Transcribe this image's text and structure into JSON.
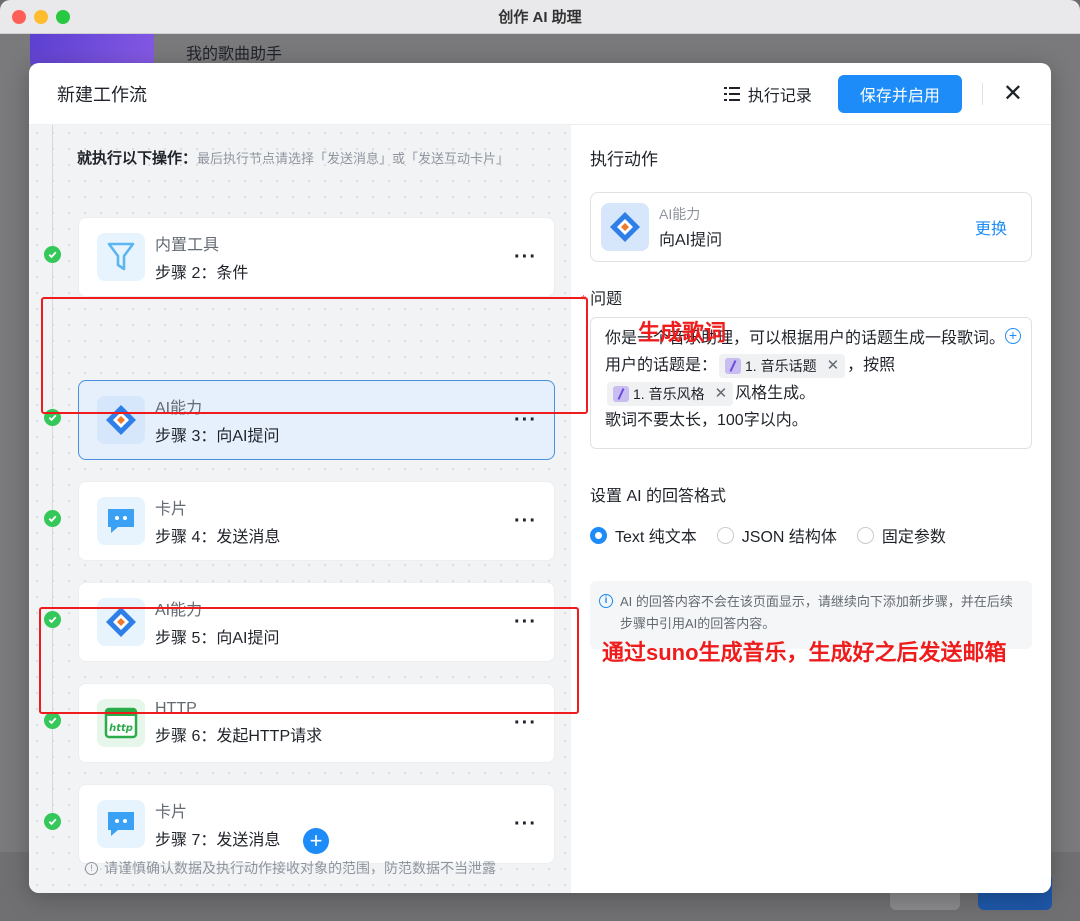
{
  "window": {
    "title": "创作 AI 助理"
  },
  "background": {
    "assistant_name": "我的歌曲助手"
  },
  "modal": {
    "title": "新建工作流",
    "history_label": "执行记录",
    "save_label": "保存并启用",
    "close_label": "✕"
  },
  "left": {
    "heading": "就执行以下操作：",
    "hint": "最后执行节点请选择「发送消息」或「发送互动卡片」",
    "steps": [
      {
        "category": "内置工具",
        "name": "步骤 2：条件",
        "icon": "filter-icon",
        "more": "···"
      },
      {
        "category": "AI能力",
        "name": "步骤 3：向AI提问",
        "icon": "ai-diamond-icon",
        "more": "···"
      },
      {
        "category": "卡片",
        "name": "步骤 4：发送消息",
        "icon": "chat-bubble-icon",
        "more": "···"
      },
      {
        "category": "AI能力",
        "name": "步骤 5：向AI提问",
        "icon": "ai-diamond-icon",
        "more": "···"
      },
      {
        "category": "HTTP",
        "name": "步骤 6：发起HTTP请求",
        "icon": "http-icon",
        "more": "···"
      },
      {
        "category": "卡片",
        "name": "步骤 7：发送消息",
        "icon": "chat-bubble-icon",
        "more": "···"
      }
    ],
    "add_label": "+",
    "footer_tip": "请谨慎确认数据及执行动作接收对象的范围，防范数据不当泄露"
  },
  "right": {
    "title": "执行动作",
    "action": {
      "category": "AI能力",
      "name": "向AI提问",
      "change_label": "更换"
    },
    "question_label": "问题",
    "question": {
      "text1": "你是一个音乐助理，可以根据用户的话题生成一段歌词。用户的话题是：",
      "tag1": "1. 音乐话题",
      "text2": "，按照",
      "tag2": "1. 音乐风格",
      "text3": "风格生成。",
      "text4": "歌词不要太长，100字以内。"
    },
    "format_label": "设置 AI 的回答格式",
    "formats": [
      {
        "label": "Text 纯文本",
        "selected": true
      },
      {
        "label": "JSON 结构体",
        "selected": false
      },
      {
        "label": "固定参数",
        "selected": false
      }
    ],
    "info": "AI 的回答内容不会在该页面显示，请继续向下添加新步骤，并在后续步骤中引用AI的回答内容。"
  },
  "annotations": {
    "lyrics": "生成歌词",
    "music": "通过suno生成音乐，生成好之后发送邮箱"
  },
  "colors": {
    "accent": "#1d8cf8",
    "success": "#34c759",
    "annotation": "#ee1c1c"
  }
}
